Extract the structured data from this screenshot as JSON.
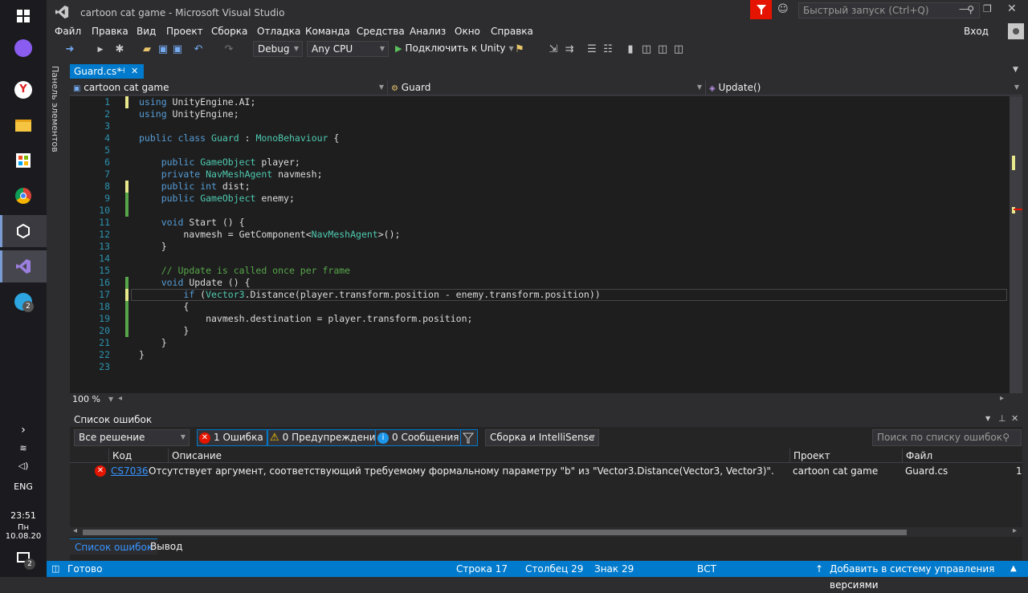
{
  "window": {
    "title": "cartoon cat game - Microsoft Visual Studio",
    "quick_launch_placeholder": "Быстрый запуск (Ctrl+Q)",
    "sign_in": "Вход"
  },
  "menu": [
    "Файл",
    "Правка",
    "Вид",
    "Проект",
    "Сборка",
    "Отладка",
    "Команда",
    "Средства",
    "Анализ",
    "Окно",
    "Справка"
  ],
  "toolbar": {
    "config": "Debug",
    "platform": "Any CPU",
    "run_label": "Подключить к Unity"
  },
  "side_panel": {
    "label": "Панель элементов"
  },
  "tab": {
    "label": "Guard.cs*"
  },
  "nav": {
    "project": "cartoon cat game",
    "class": "Guard",
    "member": "Update()"
  },
  "editor": {
    "zoom": "100 %",
    "lines": [
      {
        "n": "1",
        "tokens": [
          [
            "kw",
            "using"
          ],
          [
            "pl",
            " UnityEngine.AI;"
          ]
        ]
      },
      {
        "n": "2",
        "tokens": [
          [
            "kw",
            "using"
          ],
          [
            "pl",
            " UnityEngine;"
          ]
        ]
      },
      {
        "n": "3",
        "tokens": []
      },
      {
        "n": "4",
        "tokens": [
          [
            "kw",
            "public"
          ],
          [
            "pl",
            " "
          ],
          [
            "kw",
            "class"
          ],
          [
            "pl",
            " "
          ],
          [
            "ty",
            "Guard"
          ],
          [
            "pl",
            " : "
          ],
          [
            "ty",
            "MonoBehaviour"
          ],
          [
            "pl",
            " {"
          ]
        ]
      },
      {
        "n": "5",
        "tokens": []
      },
      {
        "n": "6",
        "tokens": [
          [
            "pl",
            "    "
          ],
          [
            "kw",
            "public"
          ],
          [
            "pl",
            " "
          ],
          [
            "ty",
            "GameObject"
          ],
          [
            "pl",
            " player;"
          ]
        ]
      },
      {
        "n": "7",
        "tokens": [
          [
            "pl",
            "    "
          ],
          [
            "kw",
            "private"
          ],
          [
            "pl",
            " "
          ],
          [
            "ty",
            "NavMeshAgent"
          ],
          [
            "pl",
            " navmesh;"
          ]
        ]
      },
      {
        "n": "8",
        "tokens": [
          [
            "pl",
            "    "
          ],
          [
            "kw",
            "public"
          ],
          [
            "pl",
            " "
          ],
          [
            "kw",
            "int"
          ],
          [
            "pl",
            " dist;"
          ]
        ]
      },
      {
        "n": "9",
        "tokens": [
          [
            "pl",
            "    "
          ],
          [
            "kw",
            "public"
          ],
          [
            "pl",
            " "
          ],
          [
            "ty",
            "GameObject"
          ],
          [
            "pl",
            " enemy;"
          ]
        ]
      },
      {
        "n": "10",
        "tokens": []
      },
      {
        "n": "11",
        "tokens": [
          [
            "pl",
            "    "
          ],
          [
            "kw",
            "void"
          ],
          [
            "pl",
            " Start () {"
          ]
        ]
      },
      {
        "n": "12",
        "tokens": [
          [
            "pl",
            "        navmesh = GetComponent<"
          ],
          [
            "ty",
            "NavMeshAgent"
          ],
          [
            "pl",
            ">();"
          ]
        ]
      },
      {
        "n": "13",
        "tokens": [
          [
            "pl",
            "    }"
          ]
        ]
      },
      {
        "n": "14",
        "tokens": []
      },
      {
        "n": "15",
        "tokens": [
          [
            "pl",
            "    "
          ],
          [
            "cm",
            "// Update is called once per frame"
          ]
        ]
      },
      {
        "n": "16",
        "tokens": [
          [
            "pl",
            "    "
          ],
          [
            "kw",
            "void"
          ],
          [
            "pl",
            " Update () {"
          ]
        ]
      },
      {
        "n": "17",
        "tokens": [
          [
            "pl",
            "        "
          ],
          [
            "kw",
            "if"
          ],
          [
            "pl",
            " ("
          ],
          [
            "ty",
            "Vector3"
          ],
          [
            "pl",
            ".Distance(player.transform.position - enemy.transform.position))"
          ]
        ]
      },
      {
        "n": "18",
        "tokens": [
          [
            "pl",
            "        {"
          ]
        ]
      },
      {
        "n": "19",
        "tokens": [
          [
            "pl",
            "            navmesh.destination = player.transform.position;"
          ]
        ]
      },
      {
        "n": "20",
        "tokens": [
          [
            "pl",
            "        }"
          ]
        ]
      },
      {
        "n": "21",
        "tokens": [
          [
            "pl",
            "    }"
          ]
        ]
      },
      {
        "n": "22",
        "tokens": [
          [
            "pl",
            "}"
          ]
        ]
      },
      {
        "n": "23",
        "tokens": []
      }
    ]
  },
  "errors": {
    "title": "Список ошибок",
    "scope": "Все решение",
    "errors_btn": "1 Ошибка",
    "warnings_btn": "0 Предупреждения",
    "messages_btn": "0 Сообщения",
    "build_filter": "Сборка и IntelliSense",
    "search_placeholder": "Поиск по списку ошибок",
    "columns": {
      "code": "Код",
      "desc": "Описание",
      "project": "Проект",
      "file": "Файл"
    },
    "row": {
      "code": "CS7036",
      "desc": "Отсутствует аргумент, соответствующий требуемому формальному параметру \"b\" из \"Vector3.Distance(Vector3, Vector3)\".",
      "project": "cartoon cat game",
      "file": "Guard.cs",
      "line": "1"
    },
    "bottom_tabs": [
      "Список ошибок",
      "Вывод"
    ]
  },
  "status": {
    "ready": "Готово",
    "row": "Строка 17",
    "col": "Столбец 29",
    "char": "Знак 29",
    "ins": "ВСТ",
    "vcs": "Добавить в систему управления версиями"
  },
  "taskbar": {
    "lang": "ENG",
    "time": "23:51",
    "date": "Пн 10.08.20",
    "notif_count": "2",
    "telegram_count": "2"
  }
}
